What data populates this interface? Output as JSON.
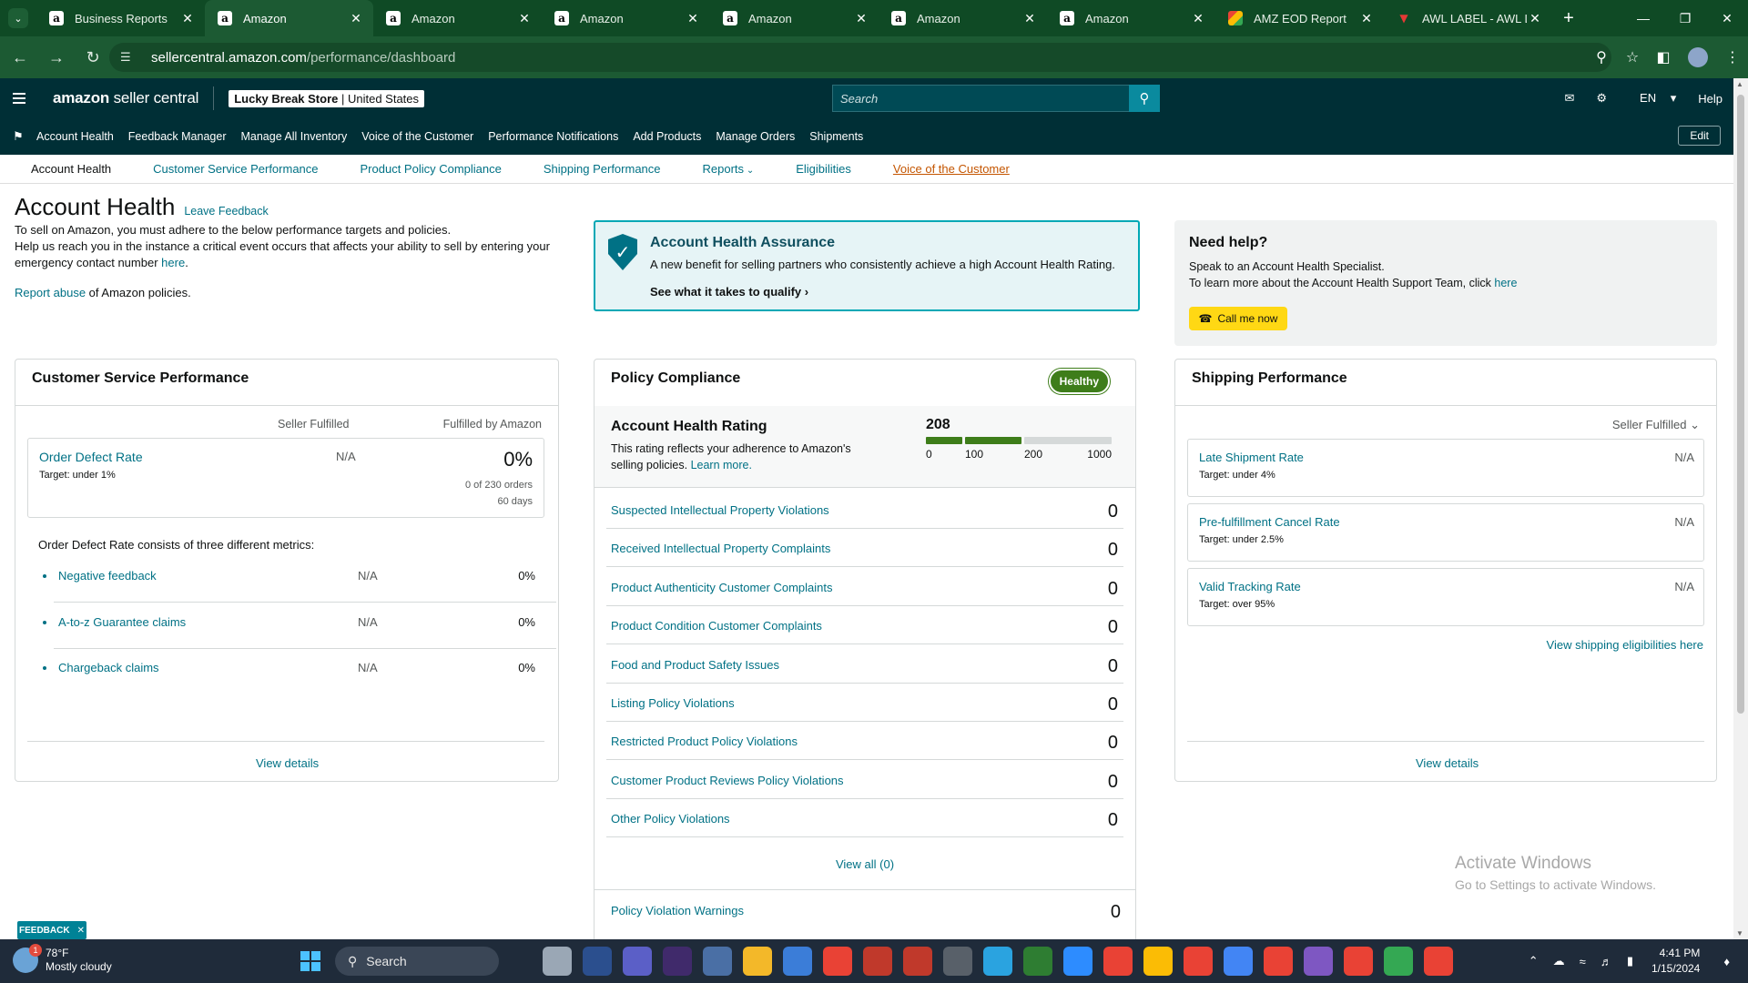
{
  "browser": {
    "tabs": [
      {
        "label": "Business Reports",
        "icon": "amazon-icon",
        "active": false
      },
      {
        "label": "Amazon",
        "icon": "amazon-icon",
        "active": true
      },
      {
        "label": "Amazon",
        "icon": "amazon-icon",
        "active": false
      },
      {
        "label": "Amazon",
        "icon": "amazon-icon",
        "active": false
      },
      {
        "label": "Amazon",
        "icon": "amazon-icon",
        "active": false
      },
      {
        "label": "Amazon",
        "icon": "amazon-icon",
        "active": false
      },
      {
        "label": "Amazon",
        "icon": "amazon-icon",
        "active": false
      },
      {
        "label": "AMZ EOD Report",
        "icon": "google-sheets-icon",
        "active": false
      },
      {
        "label": "AWL LABEL - AWL LA",
        "icon": "awl-icon",
        "active": false
      }
    ],
    "url_domain": "sellercentral.amazon.com",
    "url_path": "/performance/dashboard"
  },
  "header": {
    "logo_bold": "amazon",
    "logo_rest": " seller central",
    "store_name": "Lucky Break Store",
    "store_region": "United States",
    "search_placeholder": "Search",
    "language": "EN",
    "help": "Help"
  },
  "nav": {
    "items": [
      "Account Health",
      "Feedback Manager",
      "Manage All Inventory",
      "Voice of the Customer",
      "Performance Notifications",
      "Add Products",
      "Manage Orders",
      "Shipments"
    ],
    "edit": "Edit"
  },
  "subnav": {
    "items": [
      "Account Health",
      "Customer Service Performance",
      "Product Policy Compliance",
      "Shipping Performance",
      "Reports",
      "Eligibilities",
      "Voice of the Customer"
    ]
  },
  "page": {
    "title": "Account Health",
    "leave_feedback": "Leave Feedback",
    "intro_line1": "To sell on Amazon, you must adhere to the below performance targets and policies.",
    "intro_line2": "Help us reach you in the instance a critical event occurs that affects your ability to sell by entering your emergency contact number",
    "intro_here": "here",
    "report_abuse": "Report abuse",
    "report_abuse_rest": " of Amazon policies."
  },
  "assurance": {
    "title": "Account Health Assurance",
    "desc": "A new benefit for selling partners who consistently achieve a high Account Health Rating.",
    "link": "See what it takes to qualify"
  },
  "need_help": {
    "title": "Need help?",
    "line1": "Speak to an Account Health Specialist.",
    "line2": "To learn more about the Account Health Support Team, click",
    "here": "here",
    "call_button": "Call me now"
  },
  "csp": {
    "title": "Customer Service Performance",
    "col_seller": "Seller Fulfilled",
    "col_fba": "Fulfilled by Amazon",
    "odr_name": "Order Defect Rate",
    "odr_target": "Target: under 1%",
    "odr_seller": "N/A",
    "odr_fba": "0%",
    "odr_orders": "0 of 230 orders",
    "odr_days": "60 days",
    "note": "Order Defect Rate consists of three different metrics:",
    "metrics": [
      {
        "name": "Negative feedback",
        "seller": "N/A",
        "fba": "0%"
      },
      {
        "name": "A-to-z Guarantee claims",
        "seller": "N/A",
        "fba": "0%"
      },
      {
        "name": "Chargeback claims",
        "seller": "N/A",
        "fba": "0%"
      }
    ],
    "view_details": "View details"
  },
  "policy": {
    "title": "Policy Compliance",
    "status": "Healthy",
    "status_color": "#3e7d1a",
    "ahr_title": "Account Health Rating",
    "ahr_desc": "This rating reflects your adherence to Amazon's selling policies.",
    "ahr_learn": "Learn more.",
    "ahr_score": "208",
    "ahr_ticks": [
      "0",
      "100",
      "200",
      "1000"
    ],
    "rows": [
      {
        "name": "Suspected Intellectual Property Violations",
        "value": "0"
      },
      {
        "name": "Received Intellectual Property Complaints",
        "value": "0"
      },
      {
        "name": "Product Authenticity Customer Complaints",
        "value": "0"
      },
      {
        "name": "Product Condition Customer Complaints",
        "value": "0"
      },
      {
        "name": "Food and Product Safety Issues",
        "value": "0"
      },
      {
        "name": "Listing Policy Violations",
        "value": "0"
      },
      {
        "name": "Restricted Product Policy Violations",
        "value": "0"
      },
      {
        "name": "Customer Product Reviews Policy Violations",
        "value": "0"
      },
      {
        "name": "Other Policy Violations",
        "value": "0"
      }
    ],
    "view_all": "View all (0)",
    "warnings_name": "Policy Violation Warnings",
    "warnings_value": "0"
  },
  "shipping": {
    "title": "Shipping Performance",
    "filter": "Seller Fulfilled",
    "metrics": [
      {
        "name": "Late Shipment Rate",
        "target": "Target: under 4%",
        "value": "N/A"
      },
      {
        "name": "Pre-fulfillment Cancel Rate",
        "target": "Target: under 2.5%",
        "value": "N/A"
      },
      {
        "name": "Valid Tracking Rate",
        "target": "Target: over 95%",
        "value": "N/A"
      }
    ],
    "eligibility_link": "View shipping eligibilities here",
    "view_details": "View details"
  },
  "watermark": {
    "line1": "Activate Windows",
    "line2": "Go to Settings to activate Windows."
  },
  "feedback_tab": "FEEDBACK",
  "taskbar": {
    "weather_temp": "78°F",
    "weather_desc": "Mostly cloudy",
    "weather_badge": "1",
    "search": "Search",
    "time": "4:41 PM",
    "date": "1/15/2024"
  }
}
